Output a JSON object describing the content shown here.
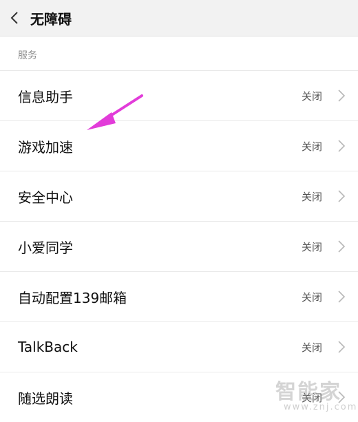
{
  "header": {
    "title": "无障碍"
  },
  "section": {
    "label": "服务"
  },
  "items": [
    {
      "label": "信息助手",
      "status": "关闭"
    },
    {
      "label": "游戏加速",
      "status": "关闭"
    },
    {
      "label": "安全中心",
      "status": "关闭"
    },
    {
      "label": "小爱同学",
      "status": "关闭"
    },
    {
      "label": "自动配置139邮箱",
      "status": "关闭"
    },
    {
      "label": "TalkBack",
      "status": "关闭"
    },
    {
      "label": "随选朗读",
      "status": "关闭"
    }
  ],
  "watermark": {
    "logo_text": "智能家",
    "url_text": "www.znj.com"
  },
  "icons": {
    "back": "back-chevron-icon",
    "row_chevron": "chevron-right-icon",
    "annotation": "pink-arrow-annotation"
  },
  "colors": {
    "annotation": "#e23cd9",
    "header_bg": "#f2f2f2"
  }
}
